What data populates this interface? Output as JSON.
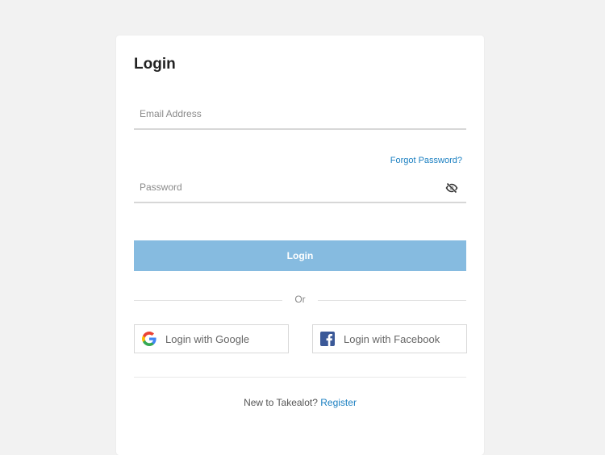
{
  "login": {
    "title": "Login",
    "email": {
      "placeholder": "Email Address",
      "value": ""
    },
    "forgot_password": "Forgot Password?",
    "password": {
      "placeholder": "Password",
      "value": ""
    },
    "password_toggle_icon": "eye-slash-icon",
    "submit_label": "Login",
    "divider_text": "Or",
    "google_label": "Login with Google",
    "google_icon": "google-icon",
    "facebook_label": "Login with Facebook",
    "facebook_icon": "facebook-icon",
    "footer_prompt": "New to Takealot?",
    "register_link": "Register"
  },
  "colors": {
    "background": "#f2f2f2",
    "card": "#ffffff",
    "primary_button": "#86bbe0",
    "link": "#1a7fc1",
    "facebook": "#3b5998"
  }
}
